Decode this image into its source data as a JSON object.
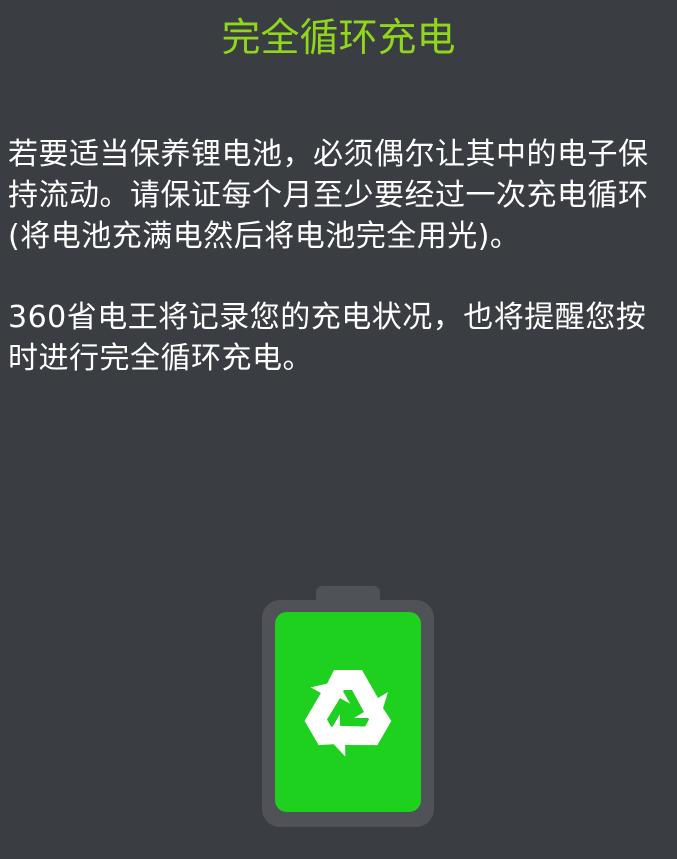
{
  "header": {
    "title": "完全循环充电"
  },
  "content": {
    "paragraph_1": "若要适当保养锂电池，必须偶尔让其中的电子保持流动。请保证每个月至少要经过一次充电循环(将电池充满电然后将电池完全用光)。",
    "paragraph_2": "360省电王将记录您的充电状况，也将提醒您按时进行完全循环充电。"
  },
  "illustration": {
    "icon": "battery-recycle-icon",
    "battery_fill_color": "#1fd11f",
    "battery_shell_color": "#4f5358",
    "symbol_color": "#ffffff"
  },
  "theme": {
    "background": "#3a3d41",
    "title_color": "#8fd61c",
    "text_color": "#ffffff"
  }
}
